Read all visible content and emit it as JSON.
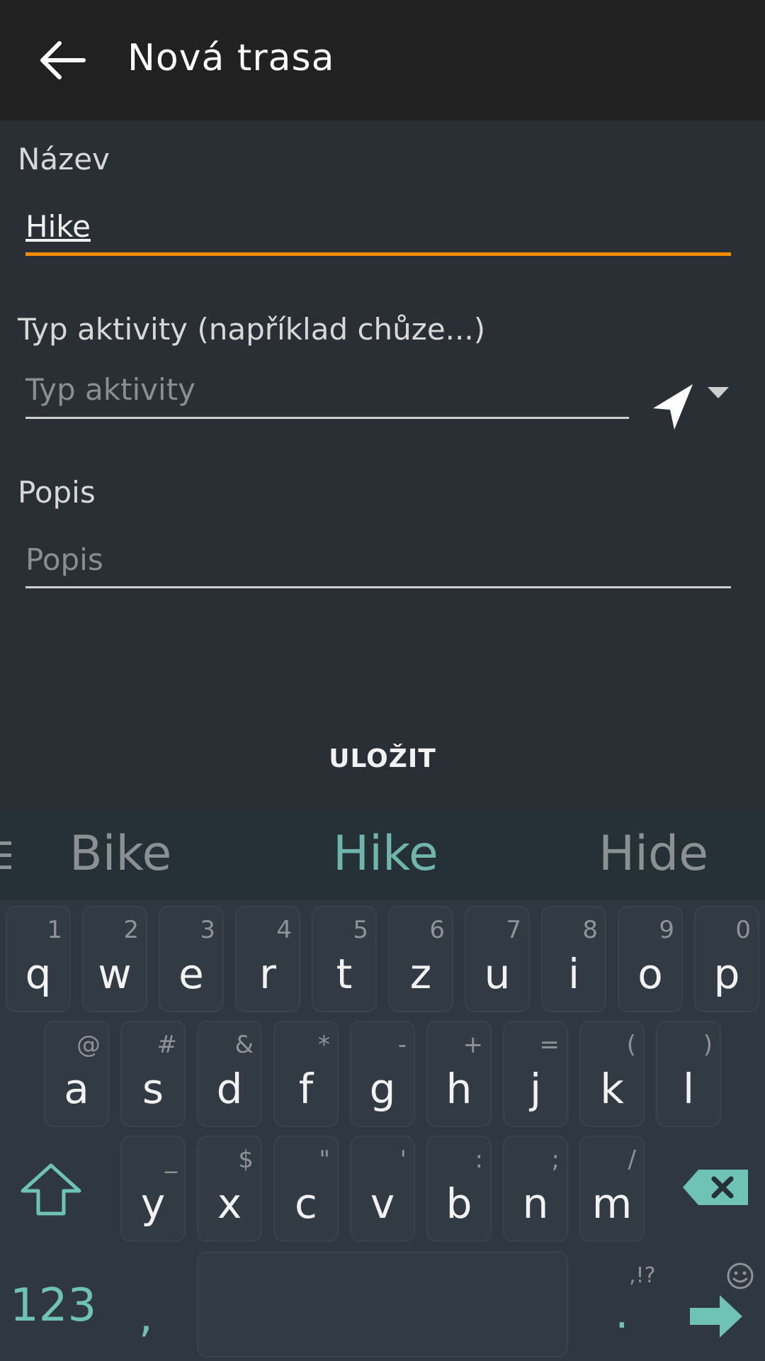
{
  "appbar": {
    "title": "Nová trasa"
  },
  "form": {
    "name_label": "Název",
    "name_value": "Hike",
    "activity_label": "Typ aktivity (například chůze...)",
    "activity_placeholder": "Typ aktivity",
    "description_label": "Popis",
    "description_placeholder": "Popis",
    "save_label": "ULOŽIT"
  },
  "keyboard": {
    "suggestions": [
      "Bike",
      "Hike",
      "Hide"
    ],
    "row1": [
      {
        "key": "q",
        "sub": "1"
      },
      {
        "key": "w",
        "sub": "2"
      },
      {
        "key": "e",
        "sub": "3"
      },
      {
        "key": "r",
        "sub": "4"
      },
      {
        "key": "t",
        "sub": "5"
      },
      {
        "key": "z",
        "sub": "6"
      },
      {
        "key": "u",
        "sub": "7"
      },
      {
        "key": "i",
        "sub": "8"
      },
      {
        "key": "o",
        "sub": "9"
      },
      {
        "key": "p",
        "sub": "0"
      }
    ],
    "row2": [
      {
        "key": "a",
        "sub": "@"
      },
      {
        "key": "s",
        "sub": "#"
      },
      {
        "key": "d",
        "sub": "&"
      },
      {
        "key": "f",
        "sub": "*"
      },
      {
        "key": "g",
        "sub": "-"
      },
      {
        "key": "h",
        "sub": "+"
      },
      {
        "key": "j",
        "sub": "="
      },
      {
        "key": "k",
        "sub": "("
      },
      {
        "key": "l",
        "sub": ")"
      }
    ],
    "row3": [
      {
        "key": "y",
        "sub": "_"
      },
      {
        "key": "x",
        "sub": "$"
      },
      {
        "key": "c",
        "sub": "\""
      },
      {
        "key": "v",
        "sub": "'"
      },
      {
        "key": "b",
        "sub": ":"
      },
      {
        "key": "n",
        "sub": ";"
      },
      {
        "key": "m",
        "sub": "/"
      }
    ],
    "numbers_label": "123",
    "comma_label": ",",
    "period_label": ".",
    "punct_label": ",!?"
  },
  "colors": {
    "accent": "#f08c00",
    "keyboard_accent": "#6fc2b6"
  }
}
